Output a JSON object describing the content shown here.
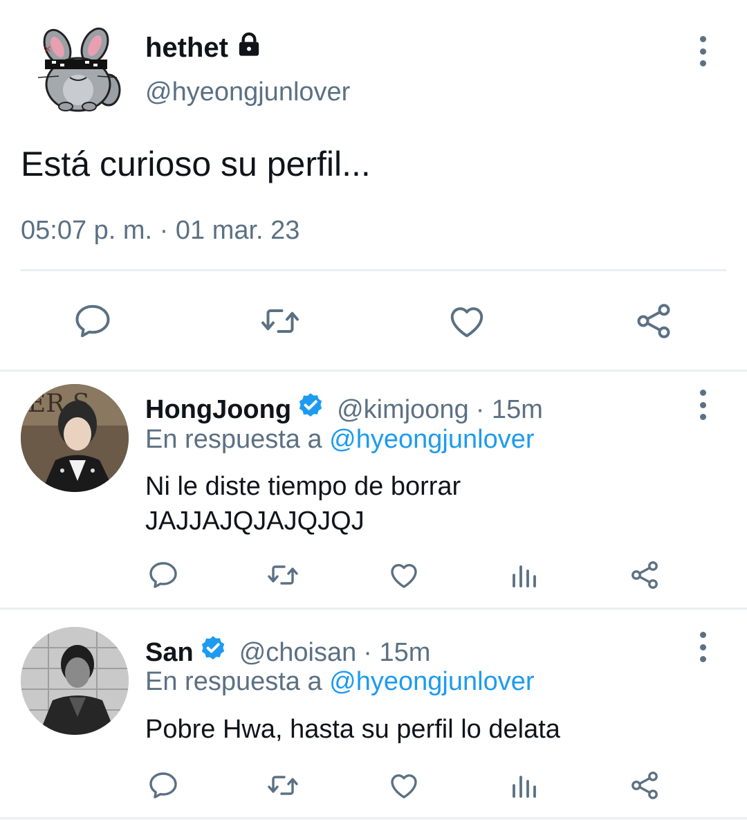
{
  "main_tweet": {
    "display_name": "hethet",
    "handle": "@hyeongjunlover",
    "text": "Está curioso su perfil...",
    "timestamp": "05:07 p. m. · 01 mar. 23",
    "protected_icon": "lock-icon",
    "actions": [
      "reply-icon",
      "retweet-icon",
      "like-icon",
      "share-icon"
    ]
  },
  "replies": [
    {
      "display_name": "HongJoong",
      "handle": "@kimjoong",
      "time": "· 15m",
      "reply_prefix": "En respuesta a",
      "reply_to": "@hyeongjunlover",
      "text_line1": "Ni le diste tiempo de borrar",
      "text_line2": "JAJJAJQJAJQJQJ",
      "verified_icon": "verified-badge-icon"
    },
    {
      "display_name": "San",
      "handle": "@choisan",
      "time": "· 15m",
      "reply_prefix": "En respuesta a",
      "reply_to": "@hyeongjunlover",
      "text_line1": "Pobre Hwa, hasta su perfil lo delata",
      "verified_icon": "verified-badge-icon"
    }
  ],
  "colors": {
    "accent": "#1d9bf0",
    "secondary_text": "#5b7083",
    "divider": "#eceff1"
  }
}
